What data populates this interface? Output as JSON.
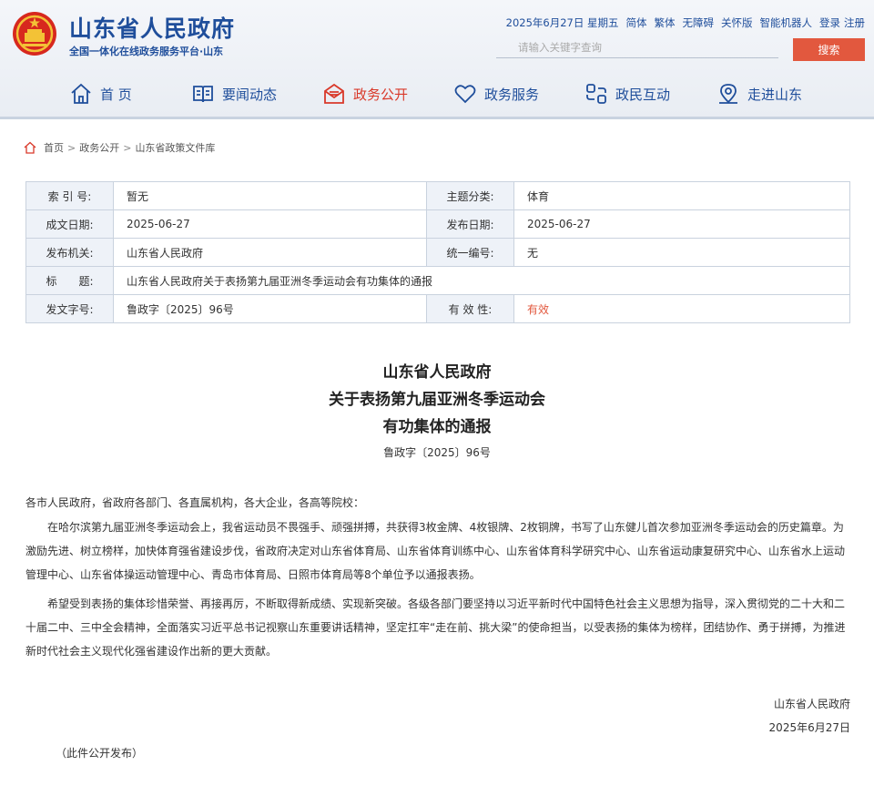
{
  "header": {
    "title": "山东省人民政府",
    "subtitle": "全国一体化在线政务服务平台·山东",
    "toplinks": [
      "2025年6月27日 星期五",
      "简体",
      "繁体",
      "无障碍",
      "关怀版",
      "智能机器人",
      "登录",
      "注册"
    ],
    "search_placeholder": "请输入关键字查询",
    "search_button": "搜索"
  },
  "nav": {
    "items": [
      {
        "label": "首 页",
        "icon": "home-icon"
      },
      {
        "label": "要闻动态",
        "icon": "book-icon"
      },
      {
        "label": "政务公开",
        "icon": "document-icon",
        "active": true
      },
      {
        "label": "政务服务",
        "icon": "heart-icon"
      },
      {
        "label": "政民互动",
        "icon": "interaction-icon"
      },
      {
        "label": "走进山东",
        "icon": "location-icon"
      }
    ],
    "accent_color": "#1f4e9b",
    "active_color": "#d9392a"
  },
  "breadcrumb": [
    "首页",
    "政务公开",
    "山东省政策文件库"
  ],
  "info": {
    "index_label": "索 引 号:",
    "index_value": "暂无",
    "topic_label": "主题分类:",
    "topic_value": "体育",
    "created_label": "成文日期:",
    "created_value": "2025-06-27",
    "published_label": "发布日期:",
    "published_value": "2025-06-27",
    "org_label": "发布机关:",
    "org_value": "山东省人民政府",
    "code_label": "统一编号:",
    "code_value": "无",
    "title_label": "标　　题:",
    "title_value": "山东省人民政府关于表扬第九届亚洲冬季运动会有功集体的通报",
    "docno_label": "发文字号:",
    "docno_value": "鲁政字〔2025〕96号",
    "validity_label": "有 效 性:",
    "validity_value": "有效"
  },
  "document": {
    "title_lines": [
      "山东省人民政府",
      "关于表扬第九届亚洲冬季运动会",
      "有功集体的通报"
    ],
    "number": "鲁政字〔2025〕96号",
    "salutation": "各市人民政府，省政府各部门、各直属机构，各大企业，各高等院校：",
    "paragraph1": "在哈尔滨第九届亚洲冬季运动会上，我省运动员不畏强手、顽强拼搏，共获得3枚金牌、4枚银牌、2枚铜牌，书写了山东健儿首次参加亚洲冬季运动会的历史篇章。为激励先进、树立榜样，加快体育强省建设步伐，省政府决定对山东省体育局、山东省体育训练中心、山东省体育科学研究中心、山东省运动康复研究中心、山东省水上运动管理中心、山东省体操运动管理中心、青岛市体育局、日照市体育局等8个单位予以通报表扬。",
    "paragraph2": "希望受到表扬的集体珍惜荣誉、再接再厉，不断取得新成绩、实现新突破。各级各部门要坚持以习近平新时代中国特色社会主义思想为指导，深入贯彻党的二十大和二十届二中、三中全会精神，全面落实习近平总书记视察山东重要讲话精神，坚定扛牢“走在前、挑大梁”的使命担当，以受表扬的集体为榜样，团结协作、勇于拼搏，为推进新时代社会主义现代化强省建设作出新的更大贡献。",
    "signer": "山东省人民政府",
    "date": "2025年6月27日",
    "note": "（此件公开发布）"
  }
}
